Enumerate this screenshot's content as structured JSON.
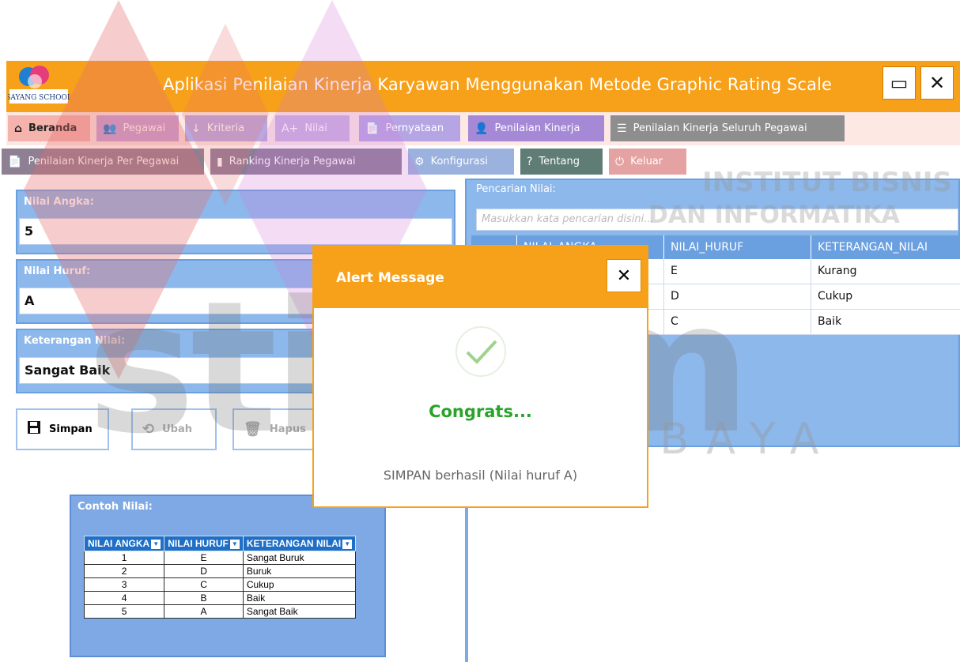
{
  "app": {
    "title": "Aplikasi Penilaian Kinerja Karyawan Menggunakan Metode Graphic Rating Scale",
    "logo_text": "SAYANG SCHOOL",
    "minimize_glyph": "▭",
    "close_glyph": "✕"
  },
  "menu_row1": [
    {
      "label": "Beranda",
      "icon": "⌂",
      "color": "#f4b3ad",
      "text_color": "#222"
    },
    {
      "label": "Pegawai",
      "icon": "👥",
      "color": "#c7a3d9",
      "text_color": "#fff"
    },
    {
      "label": "Kriteria",
      "icon": "↓",
      "color": "#b9a7df",
      "text_color": "#fff"
    },
    {
      "label": "Nilai",
      "icon": "A+",
      "color": "#c9b3e3",
      "text_color": "#fff"
    },
    {
      "label": "Pernyataan",
      "icon": "📄",
      "color": "#b5a5e4",
      "text_color": "#fff"
    },
    {
      "label": "Penilaian Kinerja",
      "icon": "👤",
      "color": "#a689d6",
      "text_color": "#fff"
    },
    {
      "label": "Penilaian Kinerja Seluruh Pegawai",
      "icon": "☰",
      "color": "#8e8e8e",
      "text_color": "#fff"
    }
  ],
  "menu_row2": [
    {
      "label": "Penilaian Kinerja Per Pegawai",
      "icon": "📄",
      "color": "#8e7f93",
      "text_color": "#fff"
    },
    {
      "label": "Ranking Kinerja Pegawai",
      "icon": "▮",
      "color": "#8b7d98",
      "text_color": "#fff"
    },
    {
      "label": "Konfigurasi",
      "icon": "⚙",
      "color": "#9bb1de",
      "text_color": "#fff"
    },
    {
      "label": "Tentang",
      "icon": "?",
      "color": "#5f7d74",
      "text_color": "#fff"
    },
    {
      "label": "Keluar",
      "icon": "⏻",
      "color": "#e5a2a2",
      "text_color": "#fff"
    }
  ],
  "form": {
    "nilai_angka_label": "Nilai Angka:",
    "nilai_angka_value": "5",
    "nilai_huruf_label": "Nilai Huruf:",
    "nilai_huruf_value": "A",
    "keterangan_label": "Keterangan Nilai:",
    "keterangan_value": "Sangat Baik"
  },
  "actions": {
    "simpan": "Simpan",
    "ubah": "Ubah",
    "hapus": "Hapus"
  },
  "contoh": {
    "label": "Contoh Nilai:",
    "headers": [
      "NILAI ANGKA",
      "NILAI HURUF",
      "KETERANGAN NILAI"
    ],
    "rows": [
      [
        "1",
        "E",
        "Sangat Buruk"
      ],
      [
        "2",
        "D",
        "Buruk"
      ],
      [
        "3",
        "C",
        "Cukup"
      ],
      [
        "4",
        "B",
        "Baik"
      ],
      [
        "5",
        "A",
        "Sangat Baik"
      ]
    ]
  },
  "search": {
    "label": "Pencarian Nilai:",
    "placeholder": "Masukkan kata pencarian disini..."
  },
  "grid": {
    "headers": [
      "",
      "NILAI_ANGKA",
      "NILAI_HURUF",
      "KETERANGAN_NILAI"
    ],
    "rows": [
      [
        "",
        "",
        "E",
        "Kurang"
      ],
      [
        "",
        "",
        "D",
        "Cukup"
      ],
      [
        "",
        "",
        "C",
        "Baik"
      ]
    ]
  },
  "alert": {
    "title": "Alert Message",
    "close_glyph": "✕",
    "congrats": "Congrats...",
    "message": "SIMPAN berhasil (Nilai huruf A)"
  },
  "watermark": {
    "line1": "INSTITUT BISNIS",
    "line2": "DAN INFORMATIKA",
    "brand": "stikom",
    "city": "SURABAYA"
  },
  "colors": {
    "accent": "#f7a11a",
    "panel_blue": "#8db8ec",
    "grid_header": "#6a9fe0",
    "success_green": "#2aa32a"
  }
}
